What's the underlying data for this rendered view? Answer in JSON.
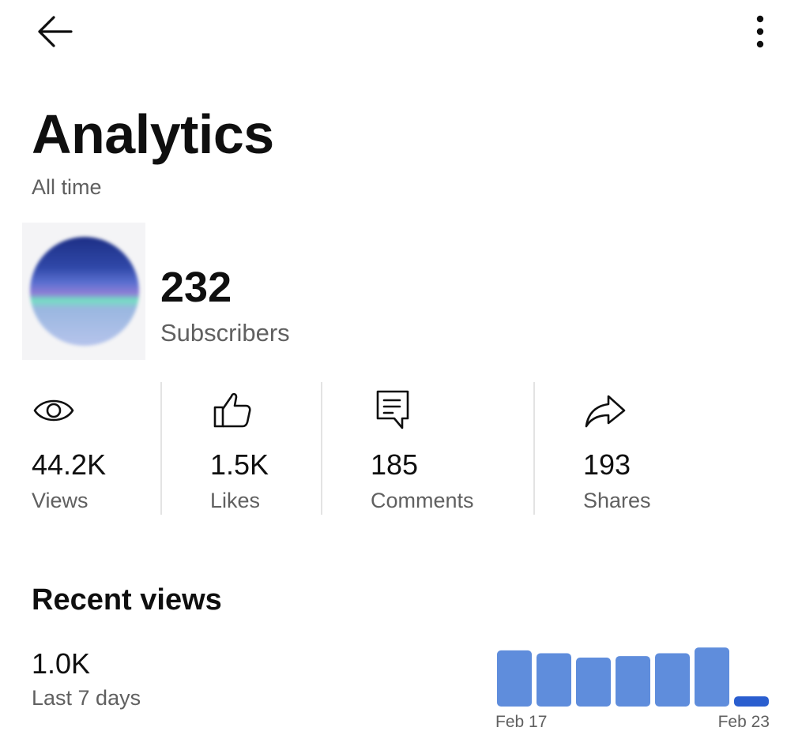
{
  "header": {
    "title": "Analytics",
    "subtitle": "All time"
  },
  "icons": {
    "back": "arrow-left-icon",
    "more": "more-vert-icon"
  },
  "channel": {
    "subscribers": "232",
    "subscribers_label": "Subscribers"
  },
  "stats": [
    {
      "value": "44.2K",
      "label": "Views",
      "icon": "eye-icon"
    },
    {
      "value": "1.5K",
      "label": "Likes",
      "icon": "thumbs-up-icon"
    },
    {
      "value": "185",
      "label": "Comments",
      "icon": "comment-icon"
    },
    {
      "value": "193",
      "label": "Shares",
      "icon": "share-icon"
    }
  ],
  "recent_views": {
    "title": "Recent views",
    "value": "1.0K",
    "period_label": "Last 7 days"
  },
  "colors": {
    "bar": "#5f8ddc",
    "bar_today": "#2a5ecf",
    "muted_text": "#606060"
  },
  "chart_data": {
    "type": "bar",
    "title": "",
    "categories": [
      "",
      "",
      "",
      "",
      "",
      "",
      ""
    ],
    "values": [
      190,
      180,
      165,
      170,
      180,
      200,
      30
    ],
    "tick_labels": [
      "Feb 17",
      "Feb 23"
    ],
    "ylim": [
      0,
      220
    ],
    "grid": false
  }
}
